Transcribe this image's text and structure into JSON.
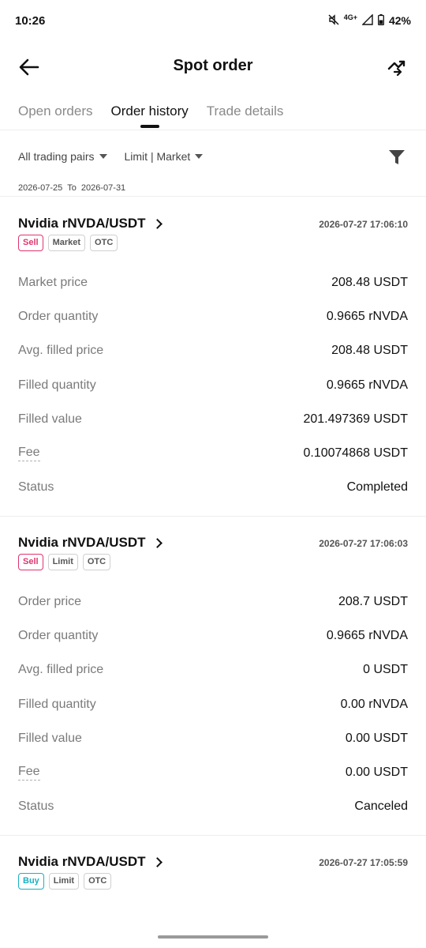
{
  "status_bar": {
    "time": "10:26",
    "network": "4G+",
    "battery": "42%"
  },
  "header": {
    "title": "Spot order",
    "back_icon": "arrow-left-icon",
    "share_icon": "share-chart-icon"
  },
  "tabs": [
    {
      "label": "Open orders",
      "active": false
    },
    {
      "label": "Order history",
      "active": true
    },
    {
      "label": "Trade details",
      "active": false
    }
  ],
  "filters": {
    "pairs": "All trading pairs",
    "type": "Limit | Market",
    "date_from": "2026-07-25",
    "date_to_label": "To",
    "date_to": "2026-07-31"
  },
  "orders": [
    {
      "pair": "Nvidia rNVDA/USDT",
      "time": "2026-07-27 17:06:10",
      "side": "Sell",
      "type": "Market",
      "venue": "OTC",
      "rows": [
        {
          "label": "Market price",
          "value": "208.48 USDT"
        },
        {
          "label": "Order quantity",
          "value": "0.9665 rNVDA"
        },
        {
          "label": "Avg. filled price",
          "value": "208.48 USDT"
        },
        {
          "label": "Filled quantity",
          "value": "0.9665 rNVDA"
        },
        {
          "label": "Filled value",
          "value": "201.497369 USDT"
        },
        {
          "label": "Fee",
          "value": "0.10074868 USDT"
        },
        {
          "label": "Status",
          "value": "Completed"
        }
      ]
    },
    {
      "pair": "Nvidia rNVDA/USDT",
      "time": "2026-07-27 17:06:03",
      "side": "Sell",
      "type": "Limit",
      "venue": "OTC",
      "rows": [
        {
          "label": "Order price",
          "value": "208.7 USDT"
        },
        {
          "label": "Order quantity",
          "value": "0.9665 rNVDA"
        },
        {
          "label": "Avg. filled price",
          "value": "0 USDT"
        },
        {
          "label": "Filled quantity",
          "value": "0.00 rNVDA"
        },
        {
          "label": "Filled value",
          "value": "0.00 USDT"
        },
        {
          "label": "Fee",
          "value": "0.00 USDT"
        },
        {
          "label": "Status",
          "value": "Canceled"
        }
      ]
    },
    {
      "pair": "Nvidia rNVDA/USDT",
      "time": "2026-07-27 17:05:59",
      "side": "Buy",
      "type": "Limit",
      "venue": "OTC",
      "rows": []
    }
  ],
  "colors": {
    "sell": "#e0356e",
    "buy": "#18b2c4",
    "muted": "#7a7a7a"
  }
}
